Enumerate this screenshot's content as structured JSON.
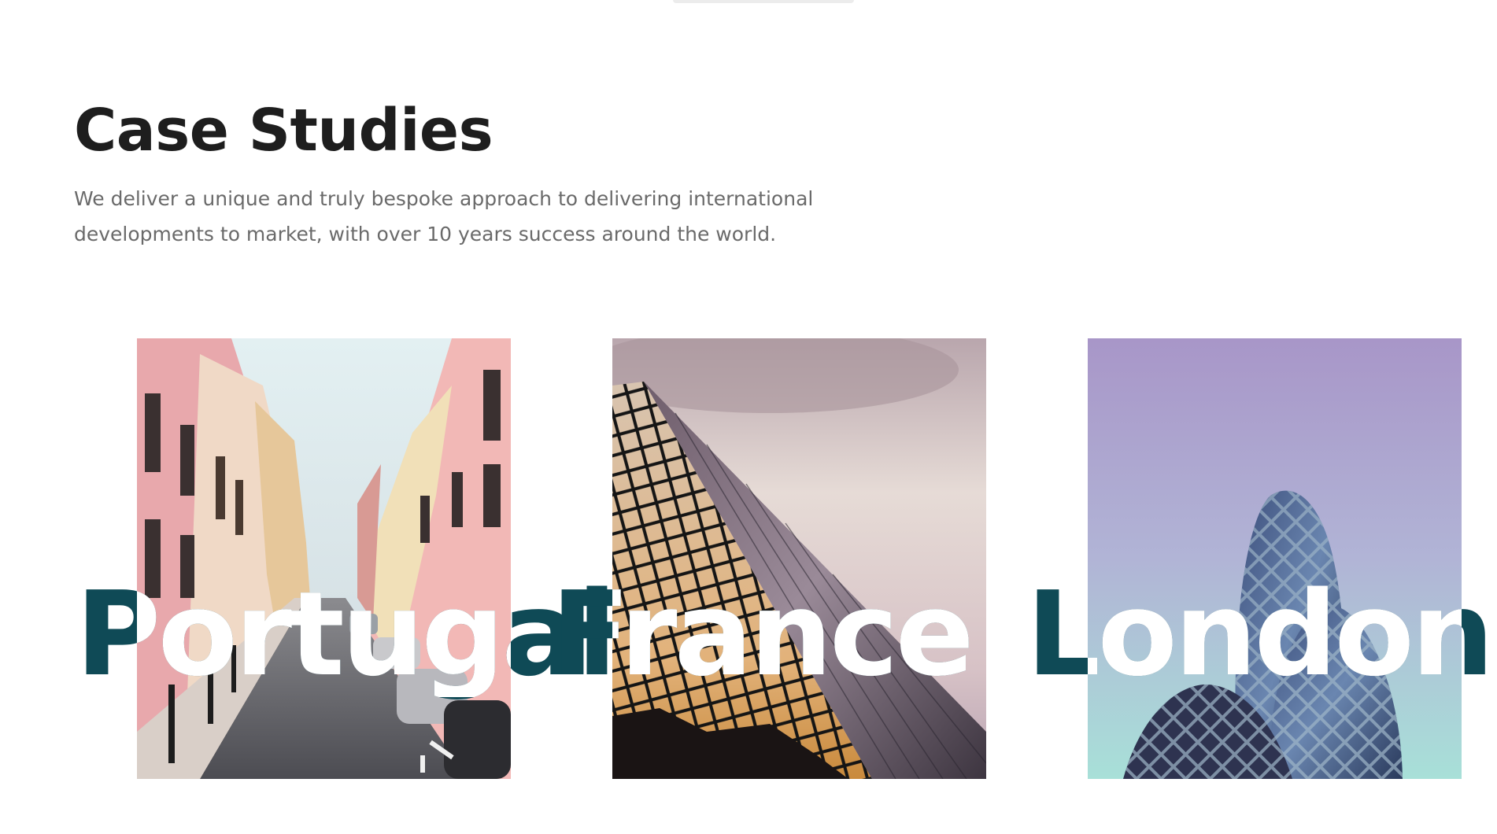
{
  "section": {
    "title": "Case Studies",
    "description": "We deliver a unique and truly bespoke approach to delivering international developments to market, with over 10 years success around the world."
  },
  "case_studies": [
    {
      "label": "Portugal",
      "image": "narrow street with pastel buildings and parked cars"
    },
    {
      "label": "France",
      "image": "glass pyramid against evening sky"
    },
    {
      "label": "London",
      "image": "glass tower domes against purple sky"
    }
  ],
  "colors": {
    "heading": "#1e1e1e",
    "body_text": "#6a6a6a",
    "label_accent": "#0f4a56",
    "label_overlay": "#ffffff"
  }
}
